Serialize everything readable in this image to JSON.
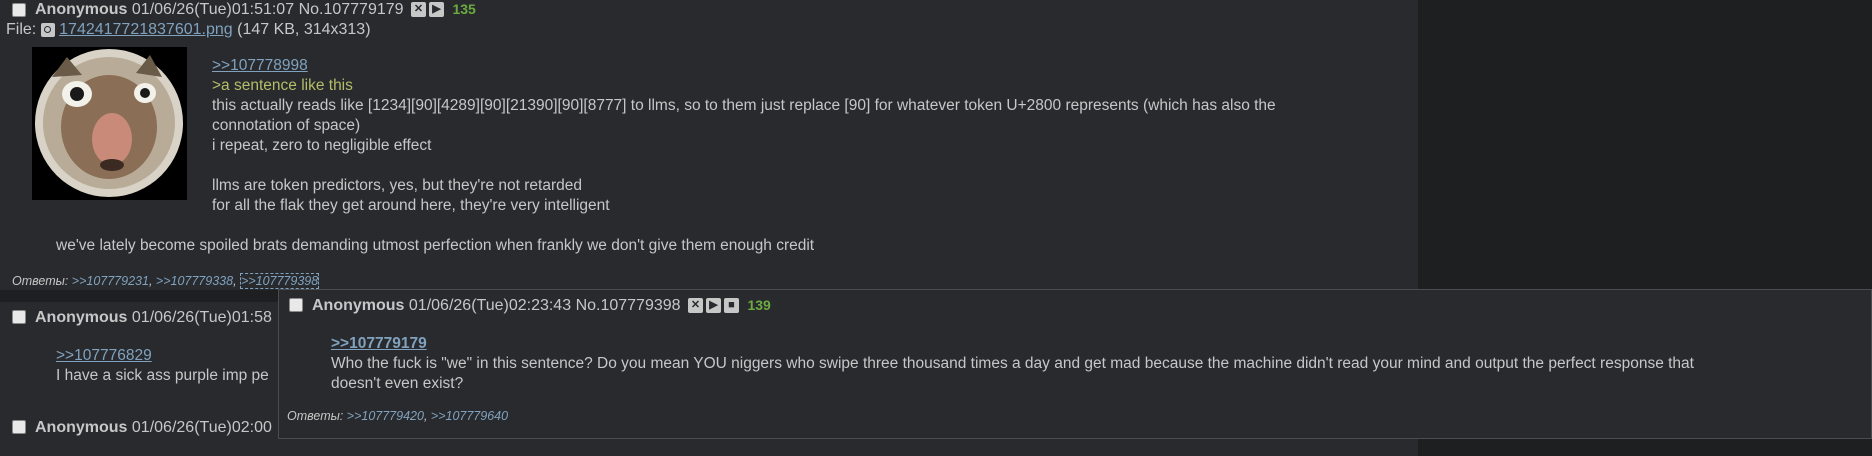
{
  "post1": {
    "name": "Anonymous",
    "datetime": "01/06/26(Tue)01:51:07",
    "number": "No.107779179",
    "count": "135",
    "file_label": "File:",
    "file_name": "1742417721837601.png",
    "file_meta": "(147 KB, 314x313)",
    "quote_link": ">>107778998",
    "greentext": ">a sentence like this",
    "lines": [
      "this actually reads like [1234][90][4289][90][21390][90][8777] to llms, so to them just replace [90] for whatever token U+2800 represents (which has also the",
      "connotation of space)",
      "i repeat, zero to negligible effect",
      "llms are token predictors, yes, but they're not retarded",
      "for all the flak they get around here, they're very intelligent",
      "we've lately become spoiled brats demanding utmost perfection when frankly we don't give them enough credit"
    ],
    "replies_label": "Ответы:",
    "replies": [
      ">>107779231",
      ">>107779338",
      ">>107779398"
    ]
  },
  "post2": {
    "name": "Anonymous",
    "datetime_partial": "01/06/26(Tue)01:58",
    "quote_link": ">>107776829",
    "line_partial": "I have a sick ass purple imp pe"
  },
  "post3": {
    "name": "Anonymous",
    "datetime_partial": "01/06/26(Tue)02:00"
  },
  "popup": {
    "name": "Anonymous",
    "datetime": "01/06/26(Tue)02:23:43",
    "number": "No.107779398",
    "count": "139",
    "quote_link": ">>107779179",
    "lines": [
      "Who the fuck is \"we\" in this sentence? Do you mean YOU niggers who swipe three thousand times a day and get mad because the machine didn't read your mind and output the perfect response that",
      "doesn't even exist?"
    ],
    "replies_label": "Ответы:",
    "replies": [
      ">>107779420",
      ">>107779640"
    ]
  },
  "icons": [
    "hide-post-icon",
    "play-icon",
    "stop-icon",
    "search-icon"
  ]
}
